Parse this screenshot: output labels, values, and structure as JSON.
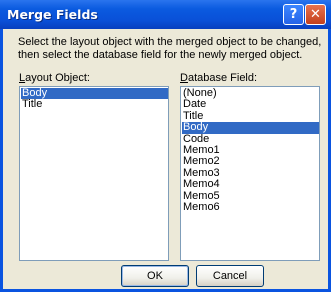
{
  "window": {
    "title": "Merge Fields",
    "help_label": "?",
    "close_label": "✕"
  },
  "instructions": "Select the layout object with the merged object to be changed, then select the database field for the newly merged object.",
  "layout_object": {
    "label_prefix": "",
    "label_underline": "L",
    "label_rest": "ayout Object:",
    "items": [
      "Body",
      "Title"
    ],
    "selected": "Body"
  },
  "database_field": {
    "label_prefix": "",
    "label_underline": "D",
    "label_rest": "atabase Field:",
    "items": [
      "(None)",
      "Date",
      "Title",
      "Body",
      "Code",
      "Memo1",
      "Memo2",
      "Memo3",
      "Memo4",
      "Memo5",
      "Memo6"
    ],
    "selected": "Body"
  },
  "buttons": {
    "ok_label": "OK",
    "cancel_label": "Cancel"
  },
  "colors": {
    "selection": "#316ac5",
    "titlebar": "#0a54e0",
    "dialog_bg": "#ece9d8"
  }
}
